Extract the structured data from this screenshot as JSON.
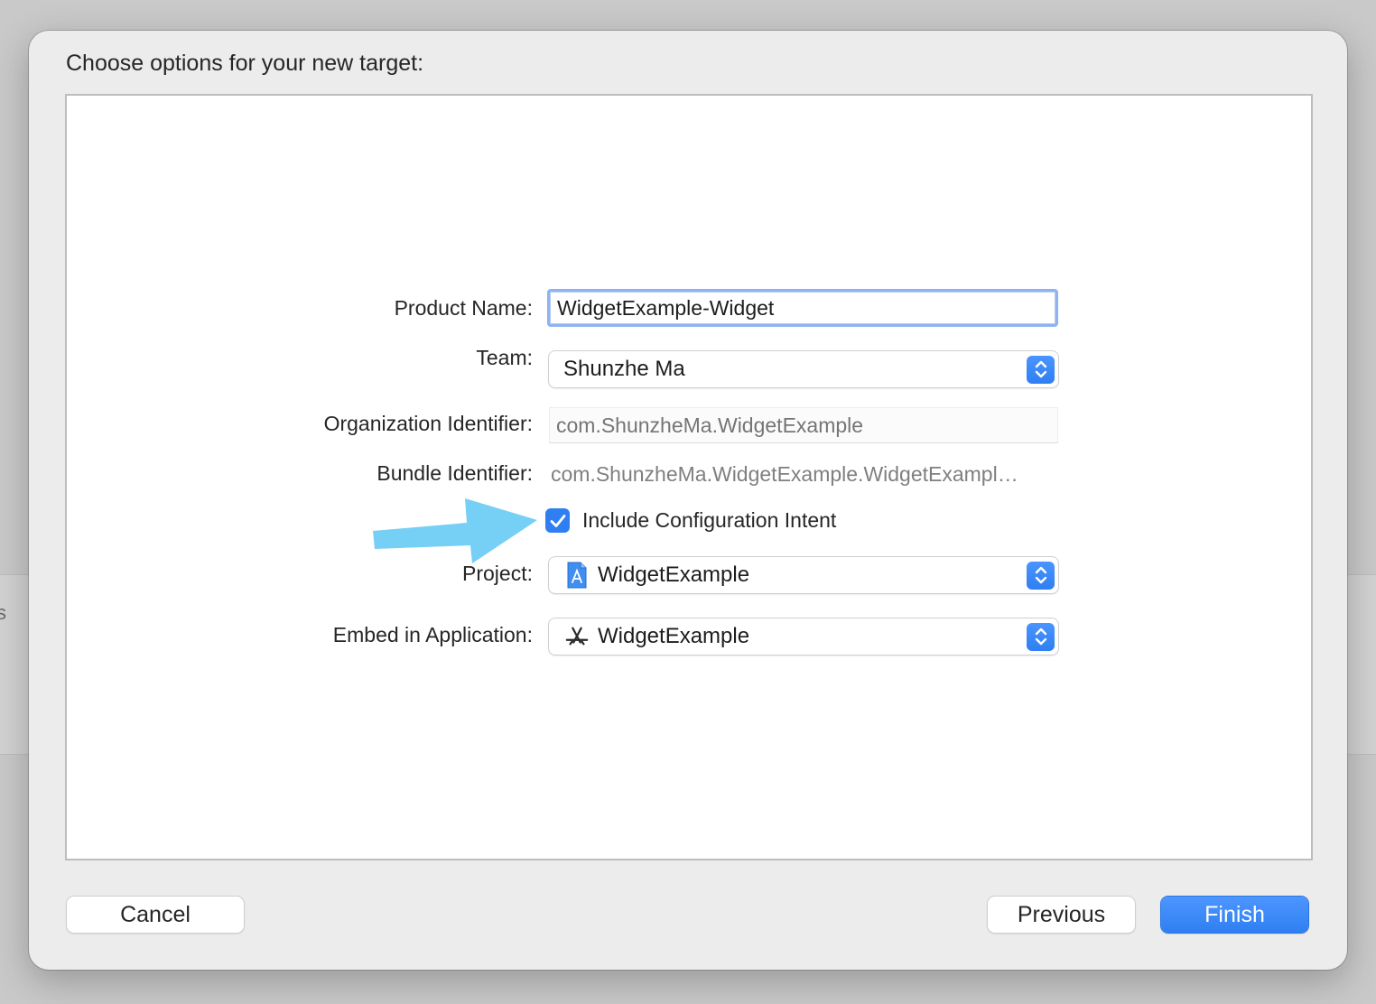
{
  "dialog": {
    "title": "Choose options for your new target:"
  },
  "form": {
    "product_name": {
      "label": "Product Name:",
      "value": "WidgetExample-Widget"
    },
    "team": {
      "label": "Team:",
      "value": "Shunzhe Ma"
    },
    "organization_identifier": {
      "label": "Organization Identifier:",
      "placeholder": "com.ShunzheMa.WidgetExample"
    },
    "bundle_identifier": {
      "label": "Bundle Identifier:",
      "value": "com.ShunzheMa.WidgetExample.WidgetExampl…"
    },
    "include_configuration_intent": {
      "label": "Include Configuration Intent",
      "checked": true
    },
    "project": {
      "label": "Project:",
      "value": "WidgetExample",
      "icon": "project-file-icon"
    },
    "embed_in_application": {
      "label": "Embed in Application:",
      "value": "WidgetExample",
      "icon": "app-store-a-icon"
    }
  },
  "buttons": {
    "cancel": "Cancel",
    "previous": "Previous",
    "finish": "Finish"
  },
  "colors": {
    "accent": "#2f7ff2",
    "annotation_arrow": "#76cff5",
    "focus_ring": "#8eb2f2"
  }
}
